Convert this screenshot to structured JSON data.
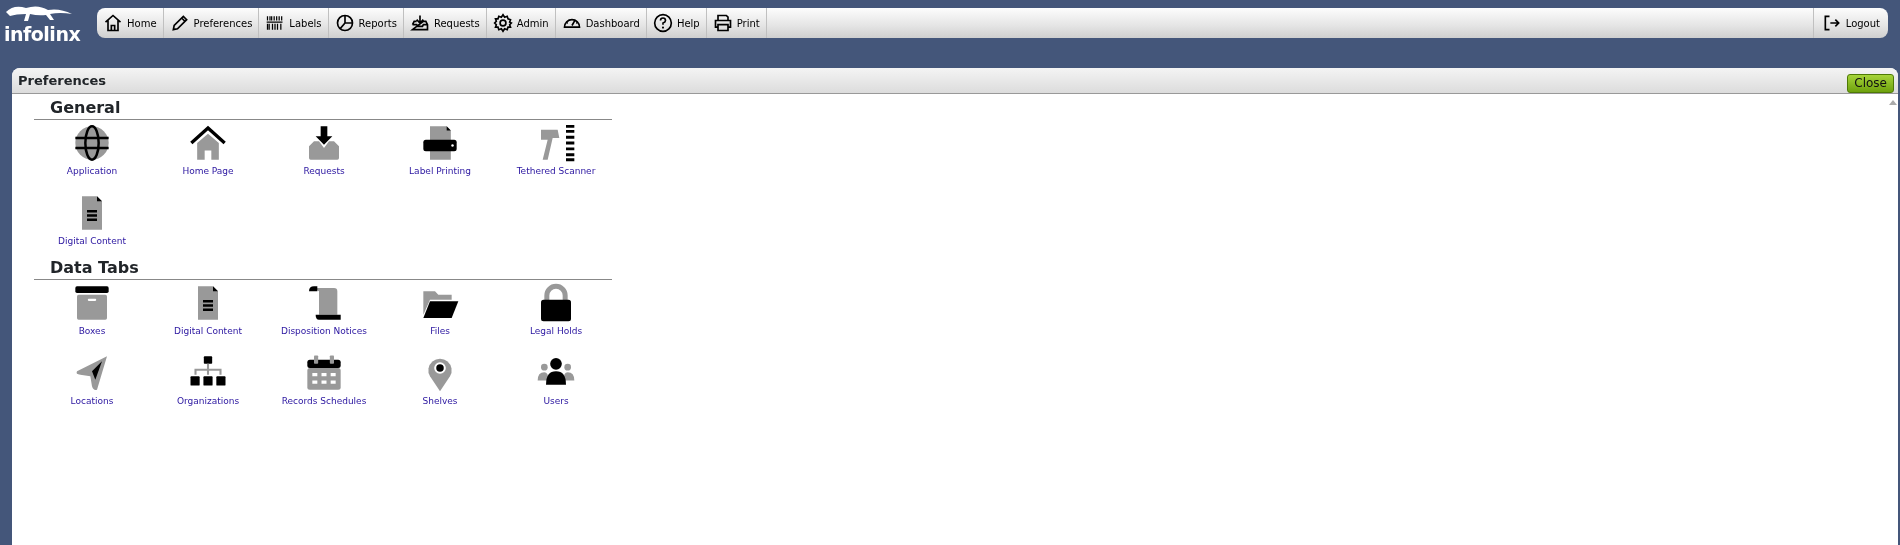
{
  "logo": {
    "text": "infolinx"
  },
  "nav": [
    {
      "label": "Home"
    },
    {
      "label": "Preferences"
    },
    {
      "label": "Labels"
    },
    {
      "label": "Reports"
    },
    {
      "label": "Requests"
    },
    {
      "label": "Admin"
    },
    {
      "label": "Dashboard"
    },
    {
      "label": "Help"
    },
    {
      "label": "Print"
    }
  ],
  "logout": {
    "label": "Logout"
  },
  "panel": {
    "title": "Preferences",
    "close": "Close"
  },
  "sections": [
    {
      "heading": "General",
      "items": [
        {
          "label": "Application"
        },
        {
          "label": "Home Page"
        },
        {
          "label": "Requests"
        },
        {
          "label": "Label Printing"
        },
        {
          "label": "Tethered Scanner"
        },
        {
          "label": "Digital Content"
        }
      ]
    },
    {
      "heading": "Data Tabs",
      "items": [
        {
          "label": "Boxes"
        },
        {
          "label": "Digital Content"
        },
        {
          "label": "Disposition Notices"
        },
        {
          "label": "Files"
        },
        {
          "label": "Legal Holds"
        },
        {
          "label": "Locations"
        },
        {
          "label": "Organizations"
        },
        {
          "label": "Records Schedules"
        },
        {
          "label": "Shelves"
        },
        {
          "label": "Users"
        }
      ]
    }
  ]
}
